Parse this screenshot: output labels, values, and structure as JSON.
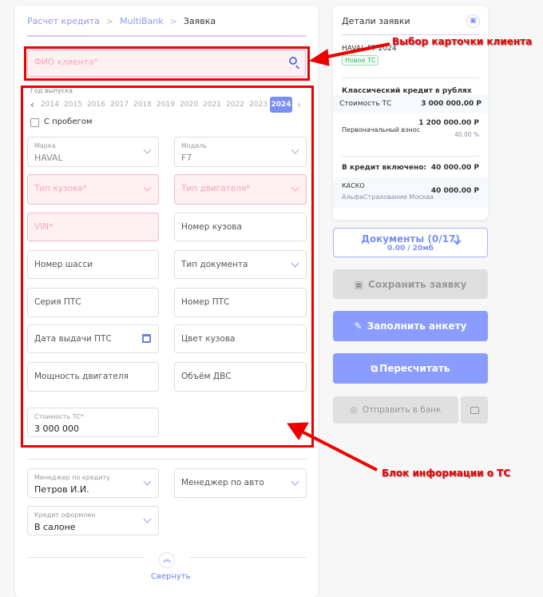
{
  "breadcrumb": [
    "Расчет кредита",
    "MultiBank",
    "Заявка"
  ],
  "client": {
    "placeholder": "ФИО клиента*"
  },
  "year": {
    "label": "Год выпуска",
    "years": [
      "2014",
      "2015",
      "2016",
      "2017",
      "2018",
      "2019",
      "2020",
      "2021",
      "2022",
      "2023",
      "2024"
    ],
    "selected": "2024"
  },
  "mileage_label": "С пробегом",
  "fields": {
    "brand": {
      "label": "Марка",
      "value": "HAVAL"
    },
    "model": {
      "label": "Модель",
      "value": "F7"
    },
    "body_type": "Тип кузова*",
    "engine_type": "Тип двигателя*",
    "vin": "VIN*",
    "body_number": "Номер кузова",
    "chassis": "Номер шасси",
    "doc_type": "Тип документа",
    "pts_series": "Серия ПТС",
    "pts_number": "Номер ПТС",
    "pts_date": "Дата выдачи ПТС",
    "color": "Цвет кузова",
    "power": "Мощность двигателя",
    "volume": "Объём ДВС",
    "price": {
      "label": "Стоимость ТС*",
      "value": "3 000 000"
    }
  },
  "managers": {
    "credit": {
      "label": "Менеджер по кредиту",
      "value": "Петров И.И."
    },
    "auto": "Менеджер по авто",
    "issued": {
      "label": "Кредит оформлен",
      "value": "В салоне"
    }
  },
  "collapse_label": "Свернуть",
  "details": {
    "title": "Детали заявки",
    "car": "HAVAL F7 2024",
    "badge": "Новое ТС",
    "credit_type": "Классический кредит в рублях",
    "price_label": "Стоимость ТС",
    "price": "3 000 000.00 Р",
    "down_label": "Первоначальный взнос",
    "down": "1 200 000.00 Р",
    "down_pct": "40.00 %",
    "included_label": "В кредит включено:",
    "included": "40 000.00 Р",
    "kasko": "КАСКО",
    "kasko_company": "АльфаСтрахование Москва",
    "kasko_sum": "40 000.00 Р"
  },
  "buttons": {
    "docs": "Документы (0/17)",
    "docs_size": "0.00 / 20мб",
    "save": "Сохранить заявку",
    "fill": "Заполнить анкету",
    "recalc": "Пересчитать",
    "send": "Отправить в банк"
  },
  "annotations": {
    "client": "Выбор карточки клиента",
    "vehicle": "Блок информации о ТС"
  },
  "colors": {
    "accent": "#8e98f0",
    "button": "#8a9cff",
    "error_bg": "#fff1f3",
    "annotation": "#ee0000"
  }
}
